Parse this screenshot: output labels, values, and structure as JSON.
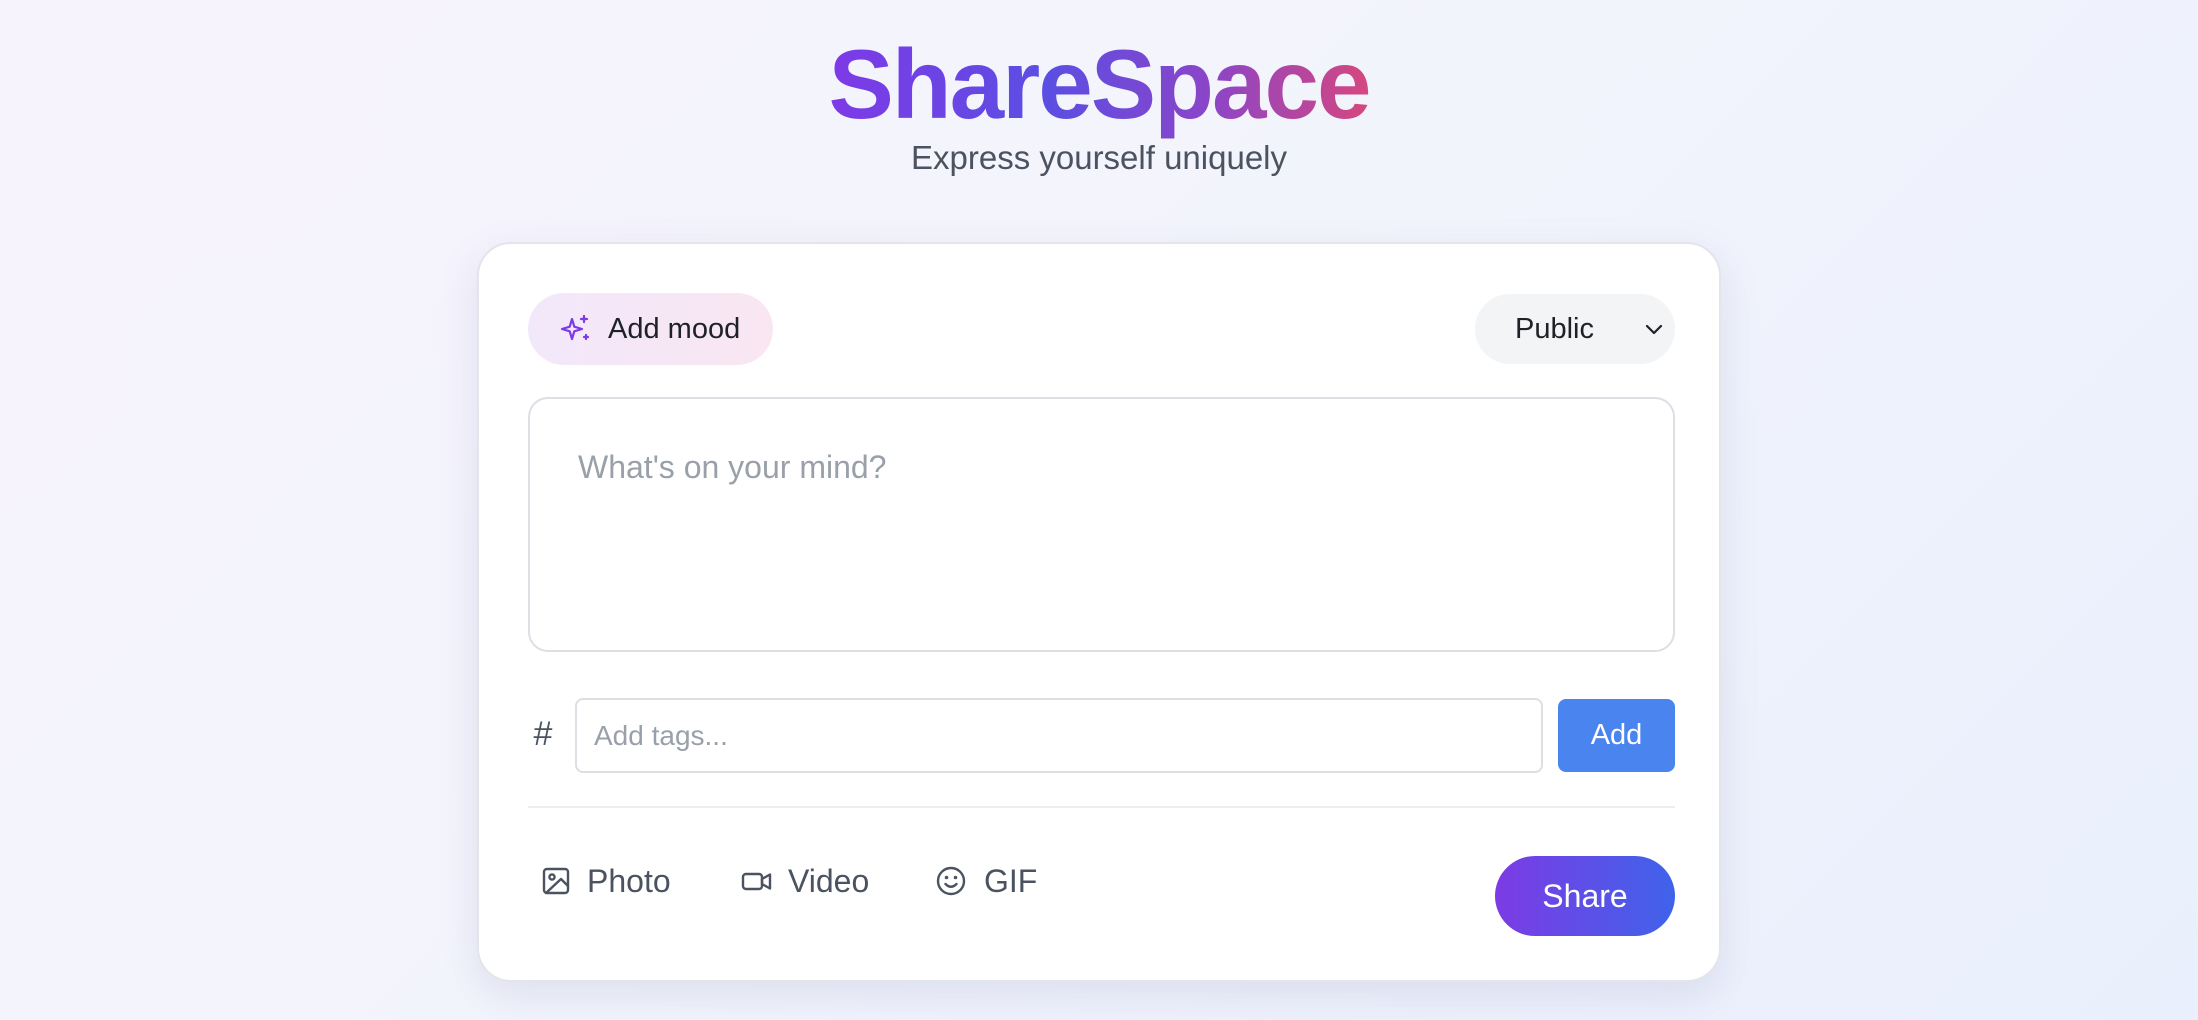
{
  "header": {
    "brand": "ShareSpace",
    "tagline": "Express yourself uniquely"
  },
  "composer": {
    "mood_button": {
      "label": "Add mood",
      "icon": "sparkles-icon"
    },
    "visibility": {
      "selected": "Public",
      "icon": "chevron-down-icon"
    },
    "post_placeholder": "What's on your mind?",
    "tags": {
      "symbol": "#",
      "placeholder": "Add tags...",
      "add_label": "Add"
    },
    "media": [
      {
        "label": "Photo",
        "icon": "image-icon"
      },
      {
        "label": "Video",
        "icon": "video-icon"
      },
      {
        "label": "GIF",
        "icon": "smile-icon"
      }
    ],
    "share_label": "Share"
  },
  "colors": {
    "brand_gradient_start": "#7e3ae6",
    "brand_gradient_end": "#d6477f",
    "add_button": "#4a84ee",
    "share_gradient_start": "#7c3be4",
    "share_gradient_end": "#3f63ea"
  }
}
